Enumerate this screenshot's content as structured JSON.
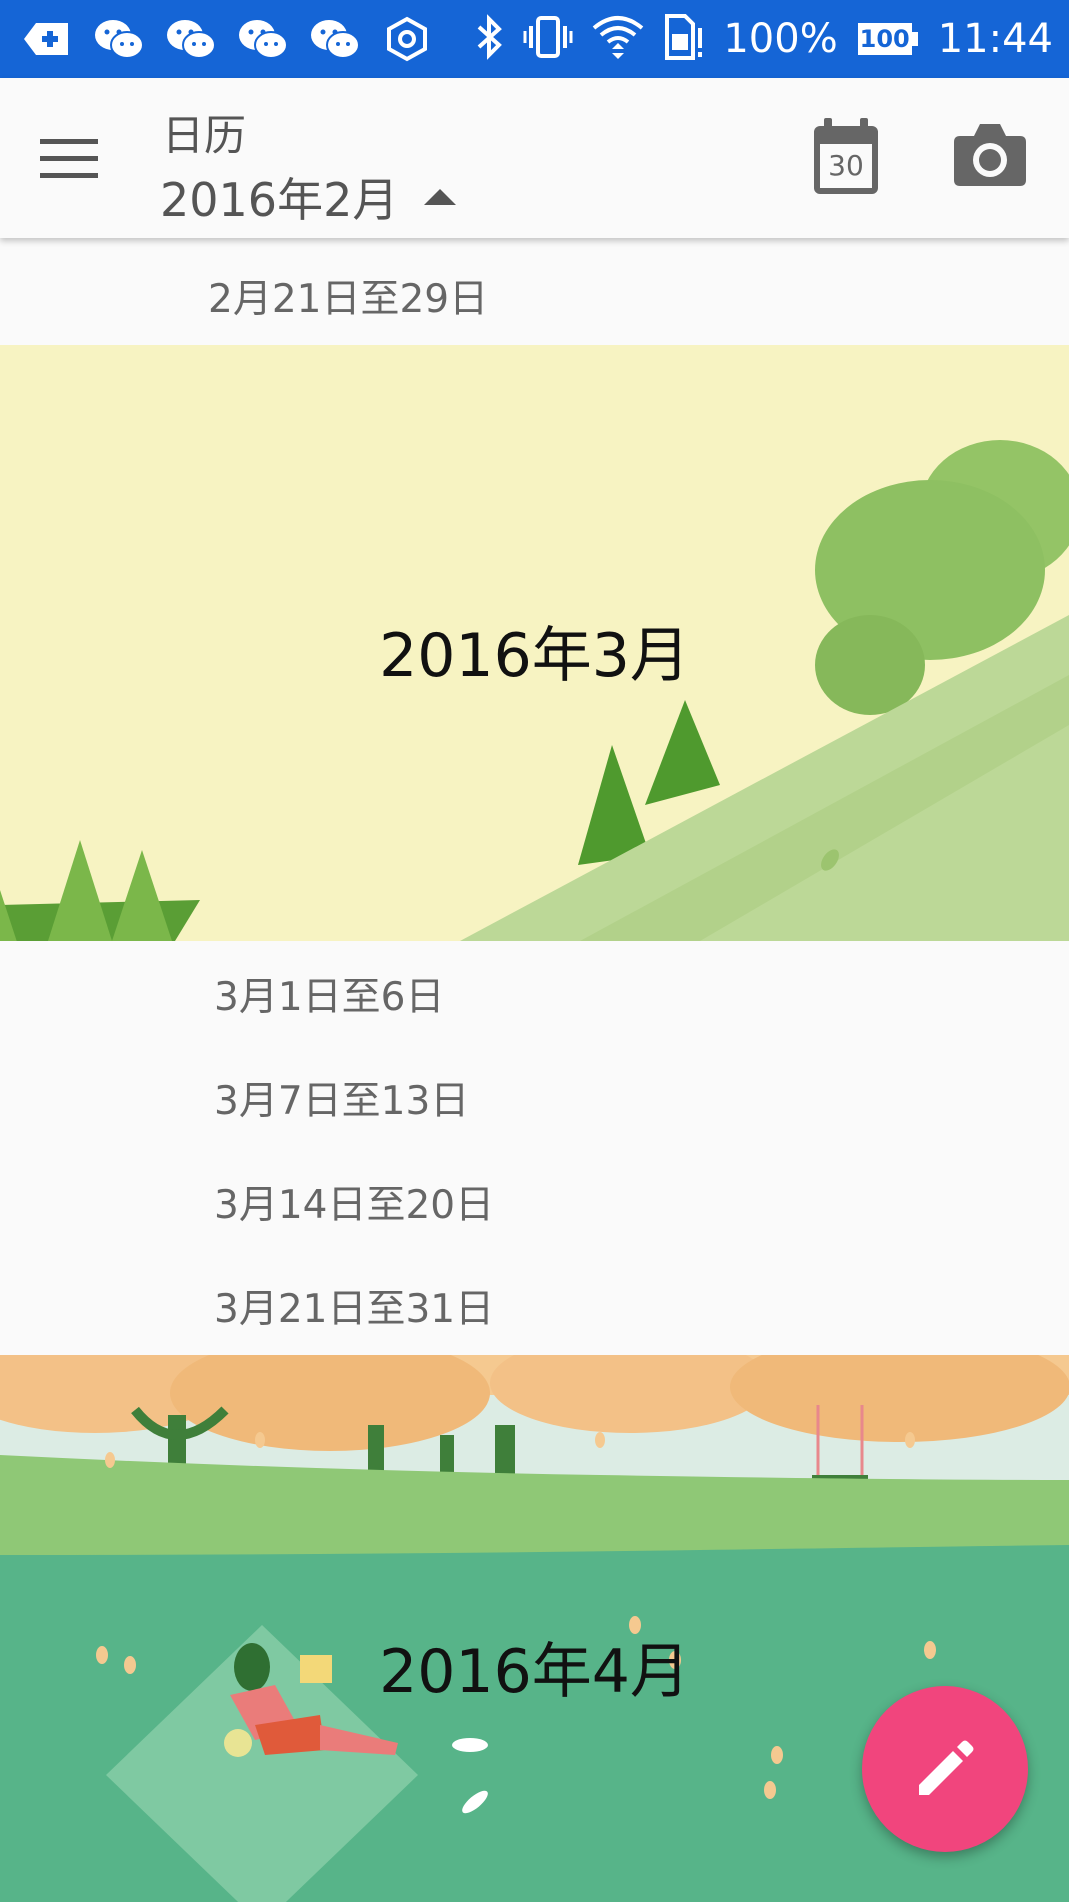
{
  "status_bar": {
    "battery_percent": "100%",
    "battery_level": "100",
    "time": "11:44",
    "icons": [
      "add-notification-icon",
      "wechat-icon",
      "wechat-icon",
      "wechat-icon",
      "wechat-icon",
      "hexagon-icon",
      "bluetooth-icon",
      "vibrate-icon",
      "wifi-icon",
      "sim-card-icon",
      "battery-icon"
    ]
  },
  "app_bar": {
    "title": "日历",
    "selected_month": "2016年2月",
    "today_date": "30"
  },
  "agenda": {
    "feb_weeks": [
      {
        "label": "2月21日至29日"
      }
    ],
    "march_banner": {
      "title": "2016年3月"
    },
    "march_weeks": [
      {
        "label": "3月1日至6日"
      },
      {
        "label": "3月7日至13日"
      },
      {
        "label": "3月14日至20日"
      },
      {
        "label": "3月21日至31日"
      }
    ],
    "april_banner": {
      "title": "2016年4月"
    }
  },
  "colors": {
    "status_bar": "#1565d6",
    "app_bar": "#fafafa",
    "fab": "#f1457d",
    "march_sky": "#f7f3c2",
    "april_grass": "#55b487"
  }
}
